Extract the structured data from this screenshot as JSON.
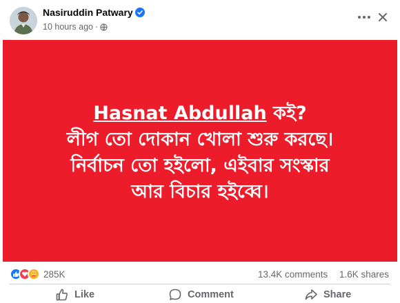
{
  "post": {
    "author": "Nasiruddin Patwary",
    "timestamp": "10 hours ago",
    "separator": "·",
    "privacy_icon": "globe-icon",
    "verified_icon": "verified-badge-icon"
  },
  "image": {
    "background": "#ec1c2a",
    "text_color": "#ffffff",
    "mention": "Hasnat Abdullah",
    "line1_rest": " কই?",
    "line2": "লীগ তো দোকান খোলা শুরু করছে।",
    "line3": "নির্বাচন তো হইলো, এইবার সংস্কার",
    "line4": "আর বিচার হইব্বে।"
  },
  "stats": {
    "reactions_count": "285K",
    "comments": "13.4K comments",
    "shares": "1.6K shares",
    "reaction_icons": [
      "like-icon",
      "love-icon",
      "care-icon"
    ]
  },
  "actions": {
    "like": "Like",
    "comment": "Comment",
    "share": "Share"
  }
}
